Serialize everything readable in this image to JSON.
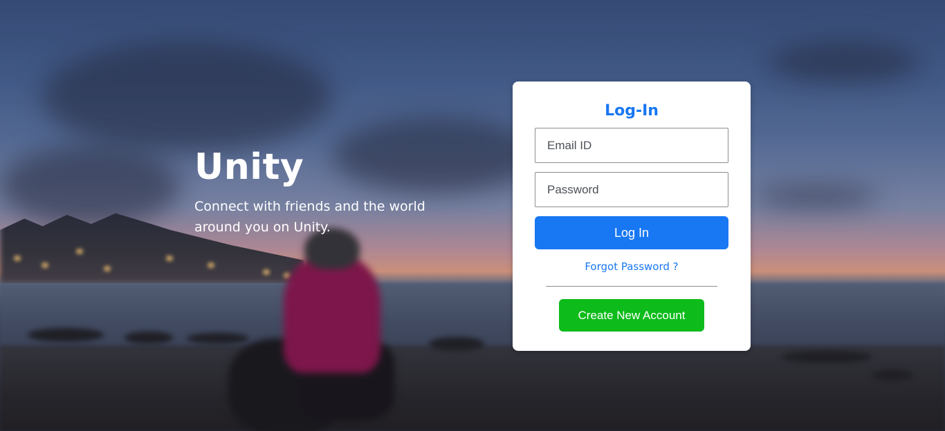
{
  "hero": {
    "brand": "Unity",
    "tagline": "Connect with friends and the world around you on Unity."
  },
  "login_card": {
    "title": "Log-In",
    "email_placeholder": "Email ID",
    "password_placeholder": "Password",
    "login_label": "Log In",
    "forgot_label": "Forgot Password ?",
    "create_label": "Create New Account"
  },
  "colors": {
    "primary": "#1877f2",
    "create": "#0dbb1a",
    "card": "#ffffff"
  }
}
